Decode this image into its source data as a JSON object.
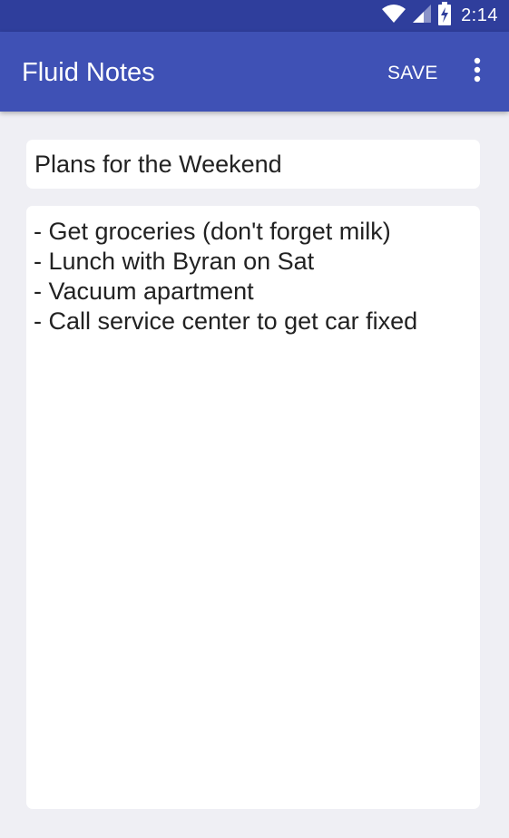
{
  "status_bar": {
    "time": "2:14",
    "icons": [
      "wifi-icon",
      "cell-signal-icon",
      "battery-charging-icon"
    ]
  },
  "app_bar": {
    "title": "Fluid Notes",
    "save_label": "SAVE",
    "overflow_icon": "more-vert-icon",
    "color": "#3f51b5",
    "status_color": "#2f3e9c"
  },
  "note": {
    "title": "Plans for the Weekend",
    "lines": [
      "- Get groceries (don't forget milk)",
      "- Lunch with Byran on Sat",
      "- Vacuum apartment",
      "- Call service center to get car fixed"
    ]
  }
}
